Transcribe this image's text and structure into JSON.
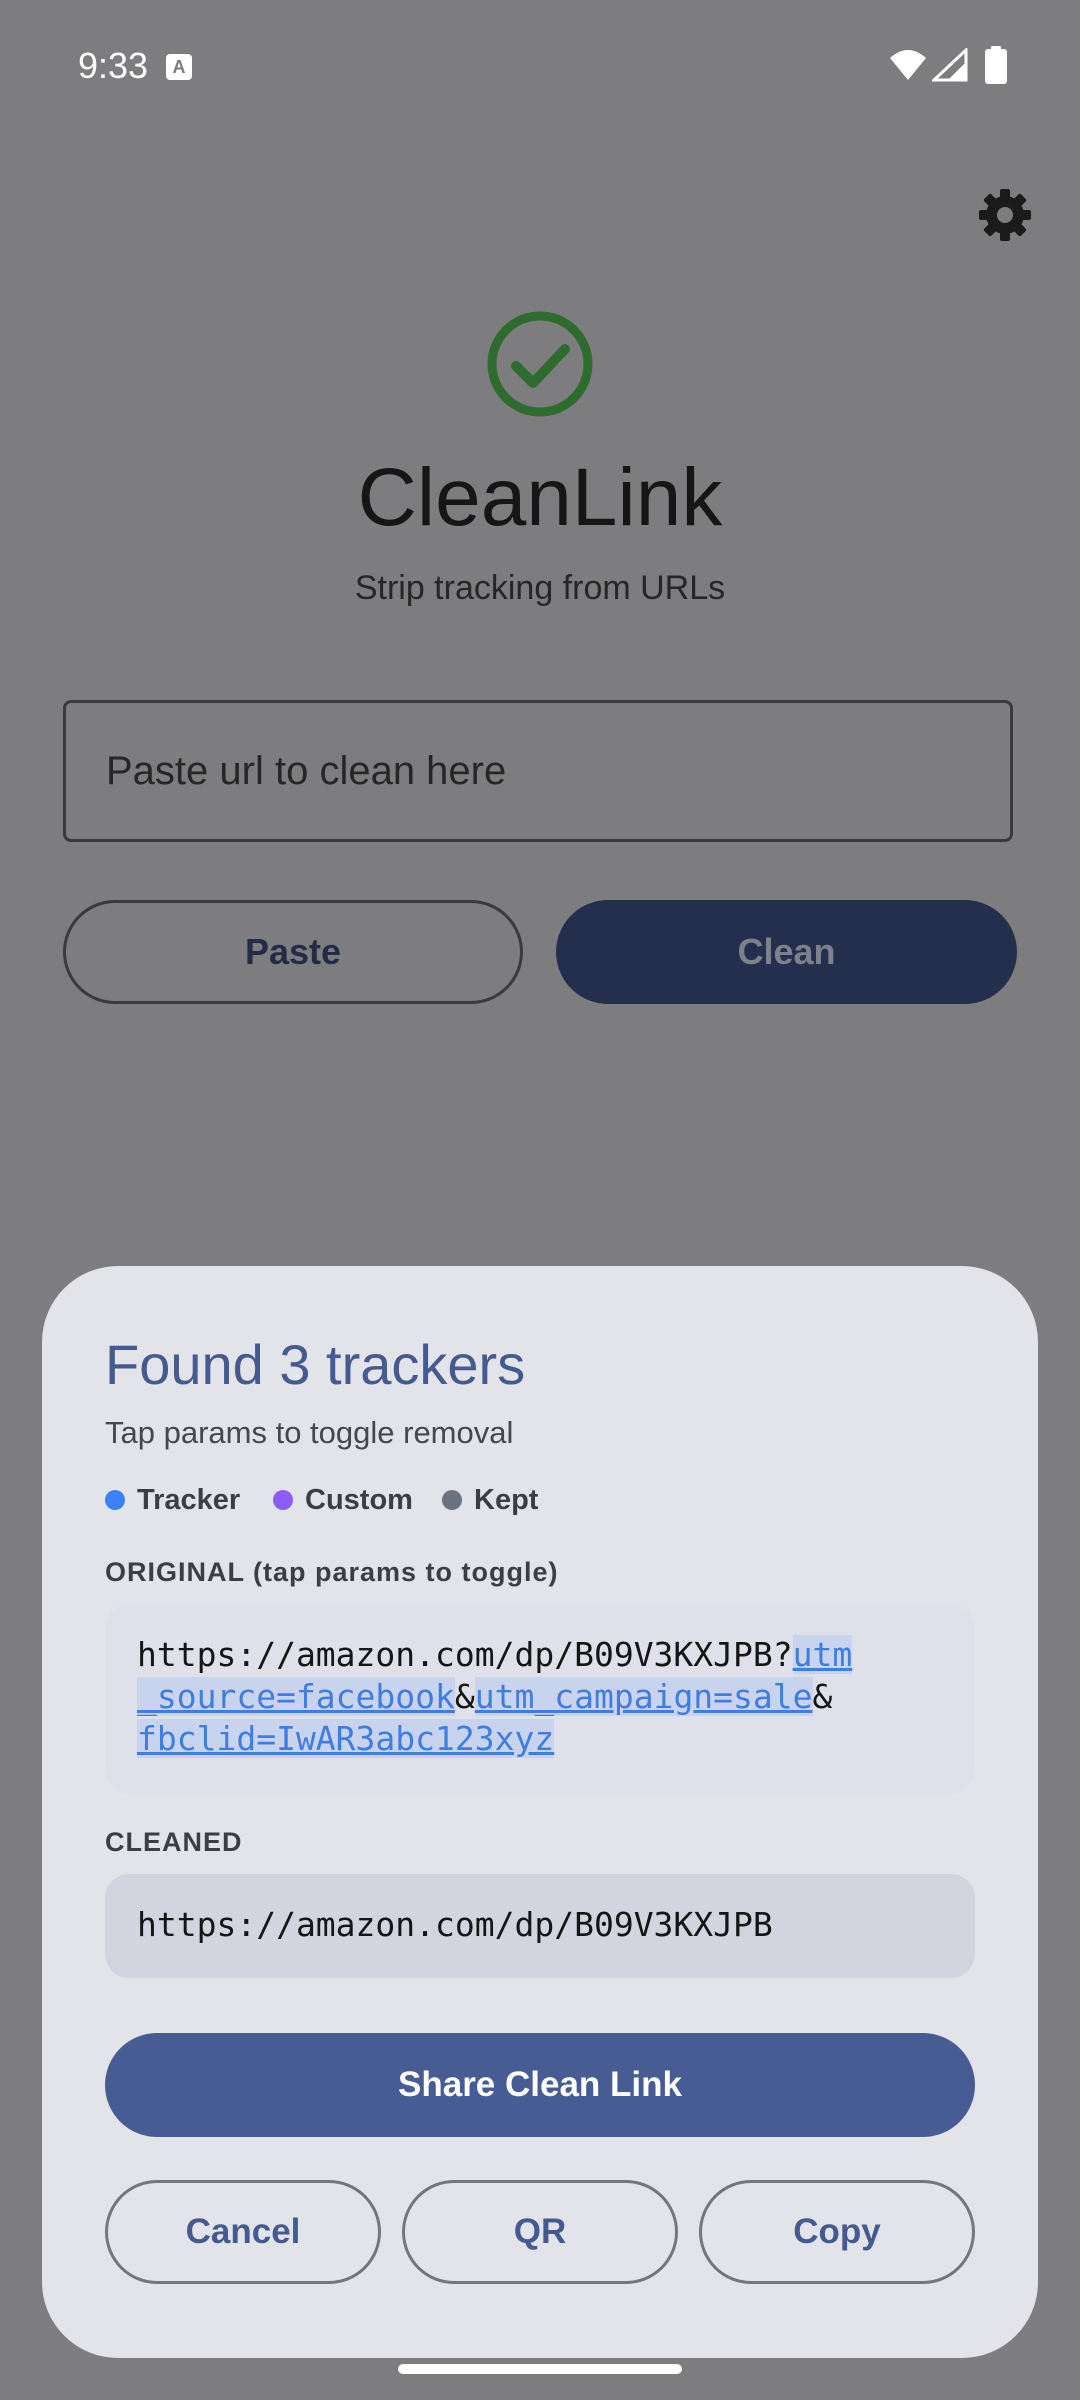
{
  "status_bar": {
    "time": "9:33",
    "notification_icon_letter": "A"
  },
  "app": {
    "title": "CleanLink",
    "subtitle": "Strip tracking from URLs",
    "input_placeholder": "Paste url to clean here",
    "paste_label": "Paste",
    "clean_label": "Clean",
    "accent_color": "#2e6b2f"
  },
  "sheet": {
    "title": "Found 3 trackers",
    "subtitle": "Tap params to toggle removal",
    "legend": {
      "tracker": {
        "label": "Tracker",
        "color": "#3b82f6"
      },
      "custom": {
        "label": "Custom",
        "color": "#8b5cf6"
      },
      "kept": {
        "label": "Kept",
        "color": "#6b7280"
      }
    },
    "original_label": "ORIGINAL (tap params to toggle)",
    "original": {
      "base": "https://amazon.com/dp/B09V3KXJPB?",
      "param1_line1": "utm",
      "param1_line2": "_source=facebook",
      "sep1": "&",
      "param2": "utm_campaign=sale",
      "sep2": "&",
      "param3": "fbclid=IwAR3abc123xyz"
    },
    "cleaned_label": "CLEANED",
    "cleaned_url": "https://amazon.com/dp/B09V3KXJPB",
    "share_label": "Share Clean Link",
    "cancel_label": "Cancel",
    "qr_label": "QR",
    "copy_label": "Copy"
  }
}
